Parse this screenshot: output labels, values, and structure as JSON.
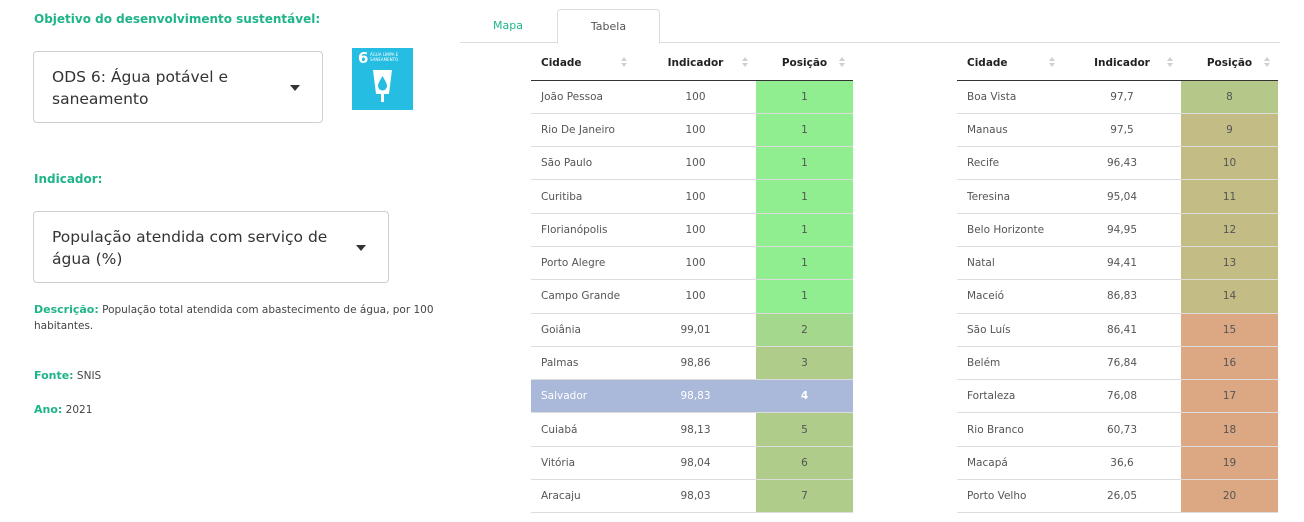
{
  "sidebar": {
    "objective_label": "Objetivo do desenvolvimento sustentável:",
    "objective_value": "ODS 6: Água potável e saneamento",
    "sdg_icon": {
      "number": "6",
      "text": "ÁGUA LIMPA E SANEAMENTO",
      "color": "#26bde2",
      "icon": "water-drop-icon"
    },
    "indicator_label": "Indicador:",
    "indicator_value": "População atendida com serviço de água (%)",
    "description_label": "Descrição:",
    "description_text": "População total atendida com abastecimento de água, por 100 habitantes.",
    "source_label": "Fonte:",
    "source_value": "SNIS",
    "year_label": "Ano:",
    "year_value": "2021"
  },
  "tabs": [
    {
      "label": "Mapa",
      "active": false
    },
    {
      "label": "Tabela",
      "active": true
    }
  ],
  "table": {
    "headers": [
      "Cidade",
      "Indicador",
      "Posição"
    ],
    "left_rows": [
      {
        "city": "João Pessoa",
        "value": "100",
        "rank": "1",
        "color": "#90ee90"
      },
      {
        "city": "Rio De Janeiro",
        "value": "100",
        "rank": "1",
        "color": "#90ee90"
      },
      {
        "city": "São Paulo",
        "value": "100",
        "rank": "1",
        "color": "#90ee90"
      },
      {
        "city": "Curitiba",
        "value": "100",
        "rank": "1",
        "color": "#90ee90"
      },
      {
        "city": "Florianópolis",
        "value": "100",
        "rank": "1",
        "color": "#90ee90"
      },
      {
        "city": "Porto Alegre",
        "value": "100",
        "rank": "1",
        "color": "#90ee90"
      },
      {
        "city": "Campo Grande",
        "value": "100",
        "rank": "1",
        "color": "#90ee90"
      },
      {
        "city": "Goiânia",
        "value": "99,01",
        "rank": "2",
        "color": "#a4d98d"
      },
      {
        "city": "Palmas",
        "value": "98,86",
        "rank": "3",
        "color": "#afcc8a"
      },
      {
        "city": "Salvador",
        "value": "98,83",
        "rank": "4",
        "color": "#aab9d9",
        "highlight": true
      },
      {
        "city": "Cuiabá",
        "value": "98,13",
        "rank": "5",
        "color": "#afcc8a"
      },
      {
        "city": "Vitória",
        "value": "98,04",
        "rank": "6",
        "color": "#afcc8a"
      },
      {
        "city": "Aracaju",
        "value": "98,03",
        "rank": "7",
        "color": "#afcc8a"
      }
    ],
    "right_rows": [
      {
        "city": "Boa Vista",
        "value": "97,7",
        "rank": "8",
        "color": "#b3c889"
      },
      {
        "city": "Manaus",
        "value": "97,5",
        "rank": "9",
        "color": "#c3bc85"
      },
      {
        "city": "Recife",
        "value": "96,43",
        "rank": "10",
        "color": "#c3bc85"
      },
      {
        "city": "Teresina",
        "value": "95,04",
        "rank": "11",
        "color": "#c3bc85"
      },
      {
        "city": "Belo Horizonte",
        "value": "94,95",
        "rank": "12",
        "color": "#c3bc85"
      },
      {
        "city": "Natal",
        "value": "94,41",
        "rank": "13",
        "color": "#c3bc85"
      },
      {
        "city": "Maceió",
        "value": "86,83",
        "rank": "14",
        "color": "#c3bc85"
      },
      {
        "city": "São Luís",
        "value": "86,41",
        "rank": "15",
        "color": "#dba883"
      },
      {
        "city": "Belém",
        "value": "76,84",
        "rank": "16",
        "color": "#dba883"
      },
      {
        "city": "Fortaleza",
        "value": "76,08",
        "rank": "17",
        "color": "#dba883"
      },
      {
        "city": "Rio Branco",
        "value": "60,73",
        "rank": "18",
        "color": "#dba883"
      },
      {
        "city": "Macapá",
        "value": "36,6",
        "rank": "19",
        "color": "#dba883"
      },
      {
        "city": "Porto Velho",
        "value": "26,05",
        "rank": "20",
        "color": "#dba883"
      }
    ]
  }
}
